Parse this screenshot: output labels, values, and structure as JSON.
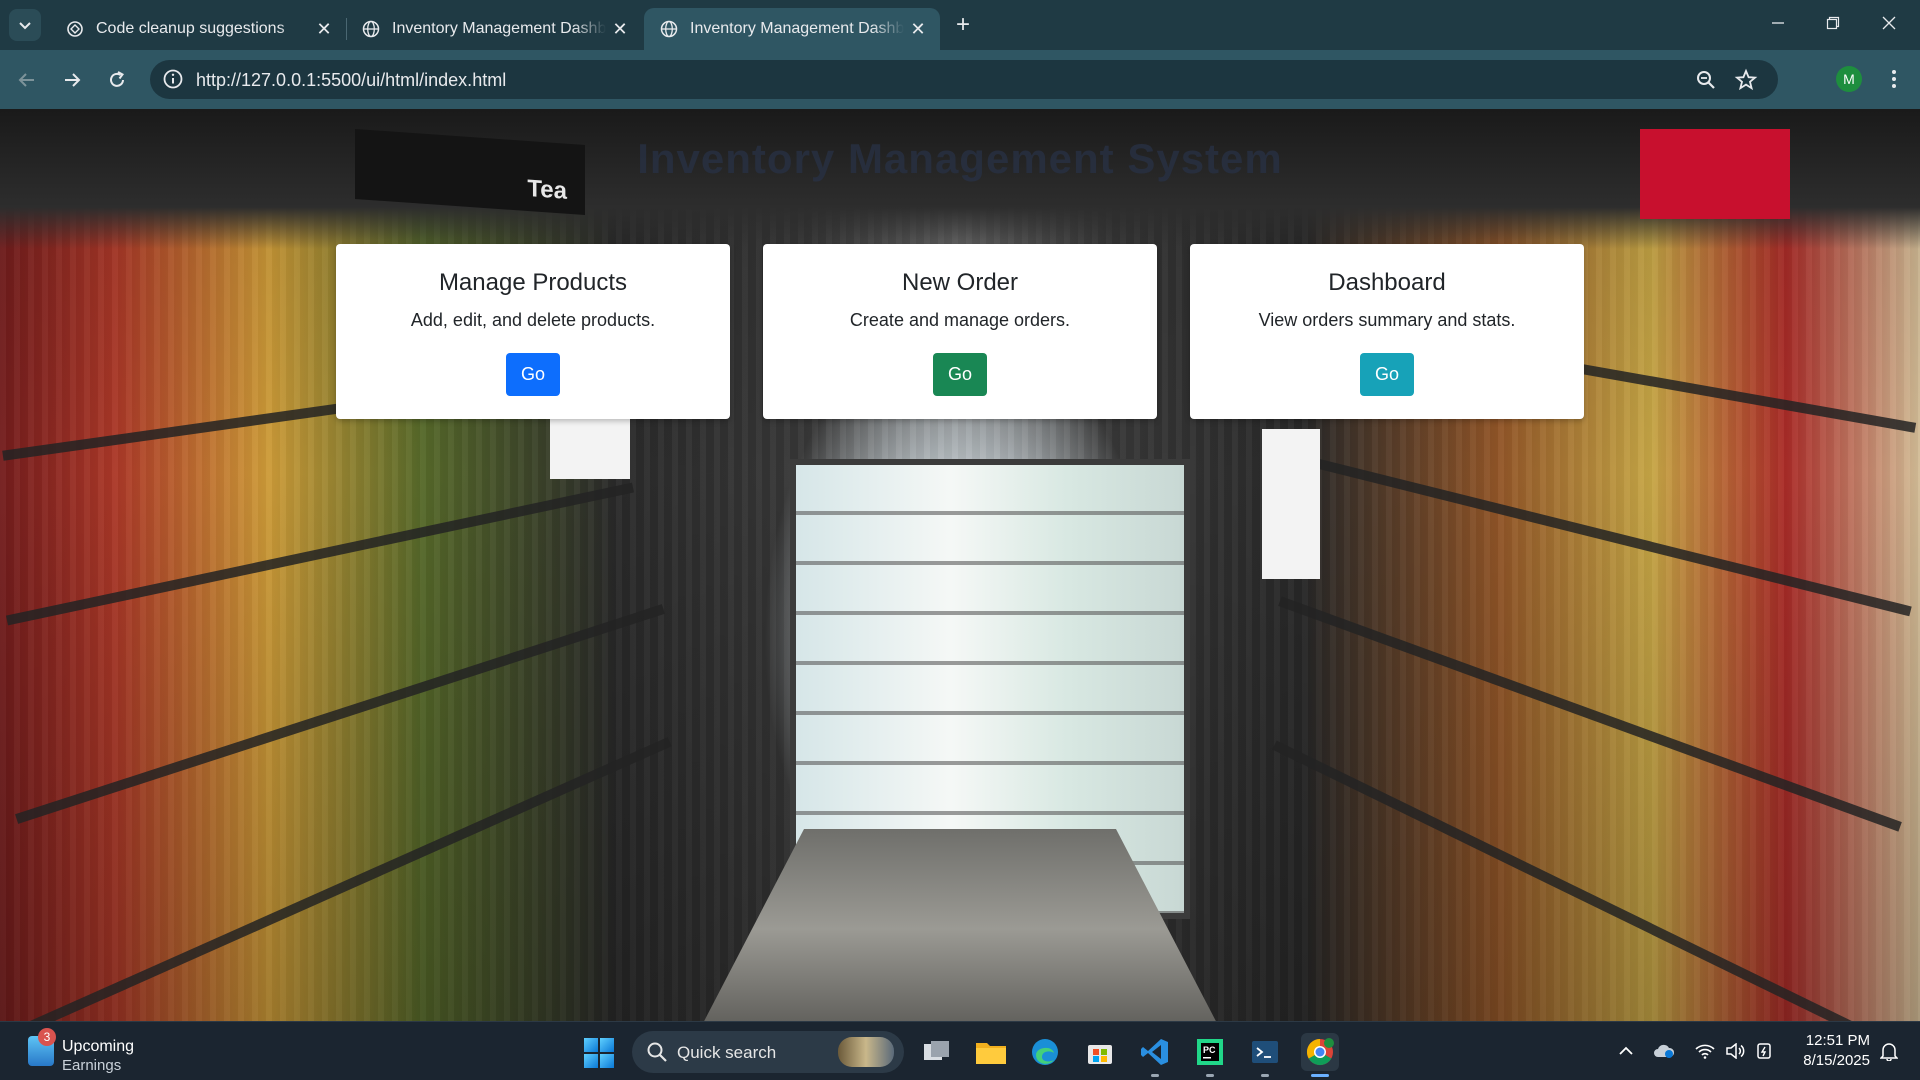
{
  "browser": {
    "tabs": [
      {
        "title": "Code cleanup suggestions",
        "active": false
      },
      {
        "title": "Inventory Management Dashboard",
        "active": false
      },
      {
        "title": "Inventory Management Dashboard",
        "active": true
      }
    ],
    "url": "http://127.0.0.1:5500/ui/html/index.html",
    "profile_initial": "M"
  },
  "page": {
    "title": "Inventory Management System",
    "background_signs": {
      "tea": "Tea"
    },
    "cards": [
      {
        "title": "Manage Products",
        "description": "Add, edit, and delete products.",
        "button_label": "Go",
        "button_color": "#0d6efd"
      },
      {
        "title": "New Order",
        "description": "Create and manage orders.",
        "button_label": "Go",
        "button_color": "#198754"
      },
      {
        "title": "Dashboard",
        "description": "View orders summary and stats.",
        "button_label": "Go",
        "button_color": "#17a2b8"
      }
    ]
  },
  "taskbar": {
    "weather_badge": "3",
    "weather_line1": "Upcoming",
    "weather_line2": "Earnings",
    "search_label": "Quick search",
    "time": "12:51 PM",
    "date": "8/15/2025"
  }
}
